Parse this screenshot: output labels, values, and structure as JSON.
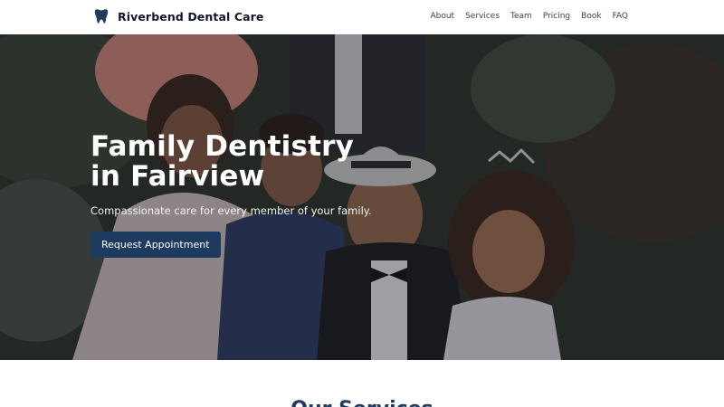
{
  "header": {
    "brand_name": "Riverbend Dental Care",
    "logo_icon": "tooth-icon",
    "nav": [
      {
        "label": "About"
      },
      {
        "label": "Services"
      },
      {
        "label": "Team"
      },
      {
        "label": "Pricing"
      },
      {
        "label": "Book"
      },
      {
        "label": "FAQ"
      }
    ]
  },
  "hero": {
    "title_line1": "Family Dentistry",
    "title_line2": "in Fairview",
    "subtitle": "Compassionate care for every member of your family.",
    "cta_label": "Request Appointment"
  },
  "services": {
    "title": "Our Services"
  },
  "colors": {
    "brand_navy": "#1e3a5f",
    "text_dark": "#111827",
    "background": "#ffffff"
  }
}
